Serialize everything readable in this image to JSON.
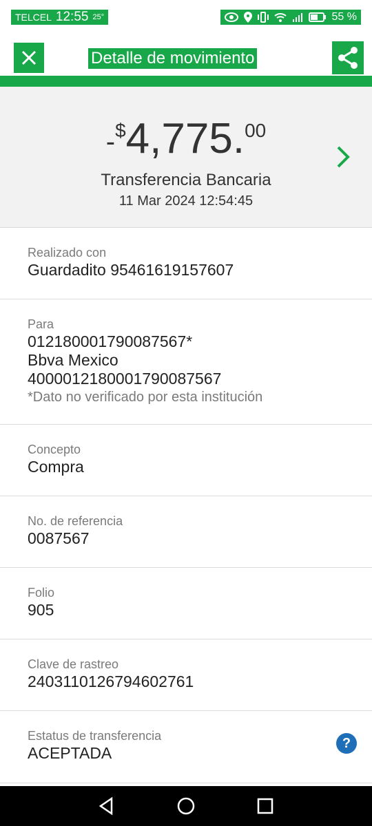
{
  "status_bar": {
    "carrier": "TELCEL",
    "time": "12:55",
    "temperature": "25°",
    "battery": "55 %",
    "icons": [
      "eye-icon",
      "location-icon",
      "vibrate-icon",
      "wifi-icon",
      "signal-icon",
      "battery-icon"
    ]
  },
  "header": {
    "title": "Detalle de movimiento",
    "close_icon": "close-icon",
    "share_icon": "share-icon"
  },
  "summary": {
    "sign": "-",
    "currency": "$",
    "amount_integer": "4,775",
    "amount_dot": ".",
    "amount_cents": "00",
    "type": "Transferencia Bancaria",
    "datetime": "11 Mar 2024 12:54:45"
  },
  "details": {
    "realizado": {
      "label": "Realizado con",
      "value": "Guardadito 95461619157607"
    },
    "para": {
      "label": "Para",
      "line1": "012180001790087567*",
      "line2": "Bbva Mexico",
      "line3": "4000012180001790087567",
      "note": "*Dato no verificado por esta institución"
    },
    "concepto": {
      "label": "Concepto",
      "value": "Compra"
    },
    "referencia": {
      "label": "No. de referencia",
      "value": "0087567"
    },
    "folio": {
      "label": "Folio",
      "value": "905"
    },
    "rastreo": {
      "label": "Clave de rastreo",
      "value": "2403110126794602761"
    },
    "estatus": {
      "label": "Estatus de transferencia",
      "value": "ACEPTADA",
      "help": "?"
    }
  },
  "colors": {
    "accent_green": "#18a84a",
    "help_blue": "#1f6fb8"
  }
}
